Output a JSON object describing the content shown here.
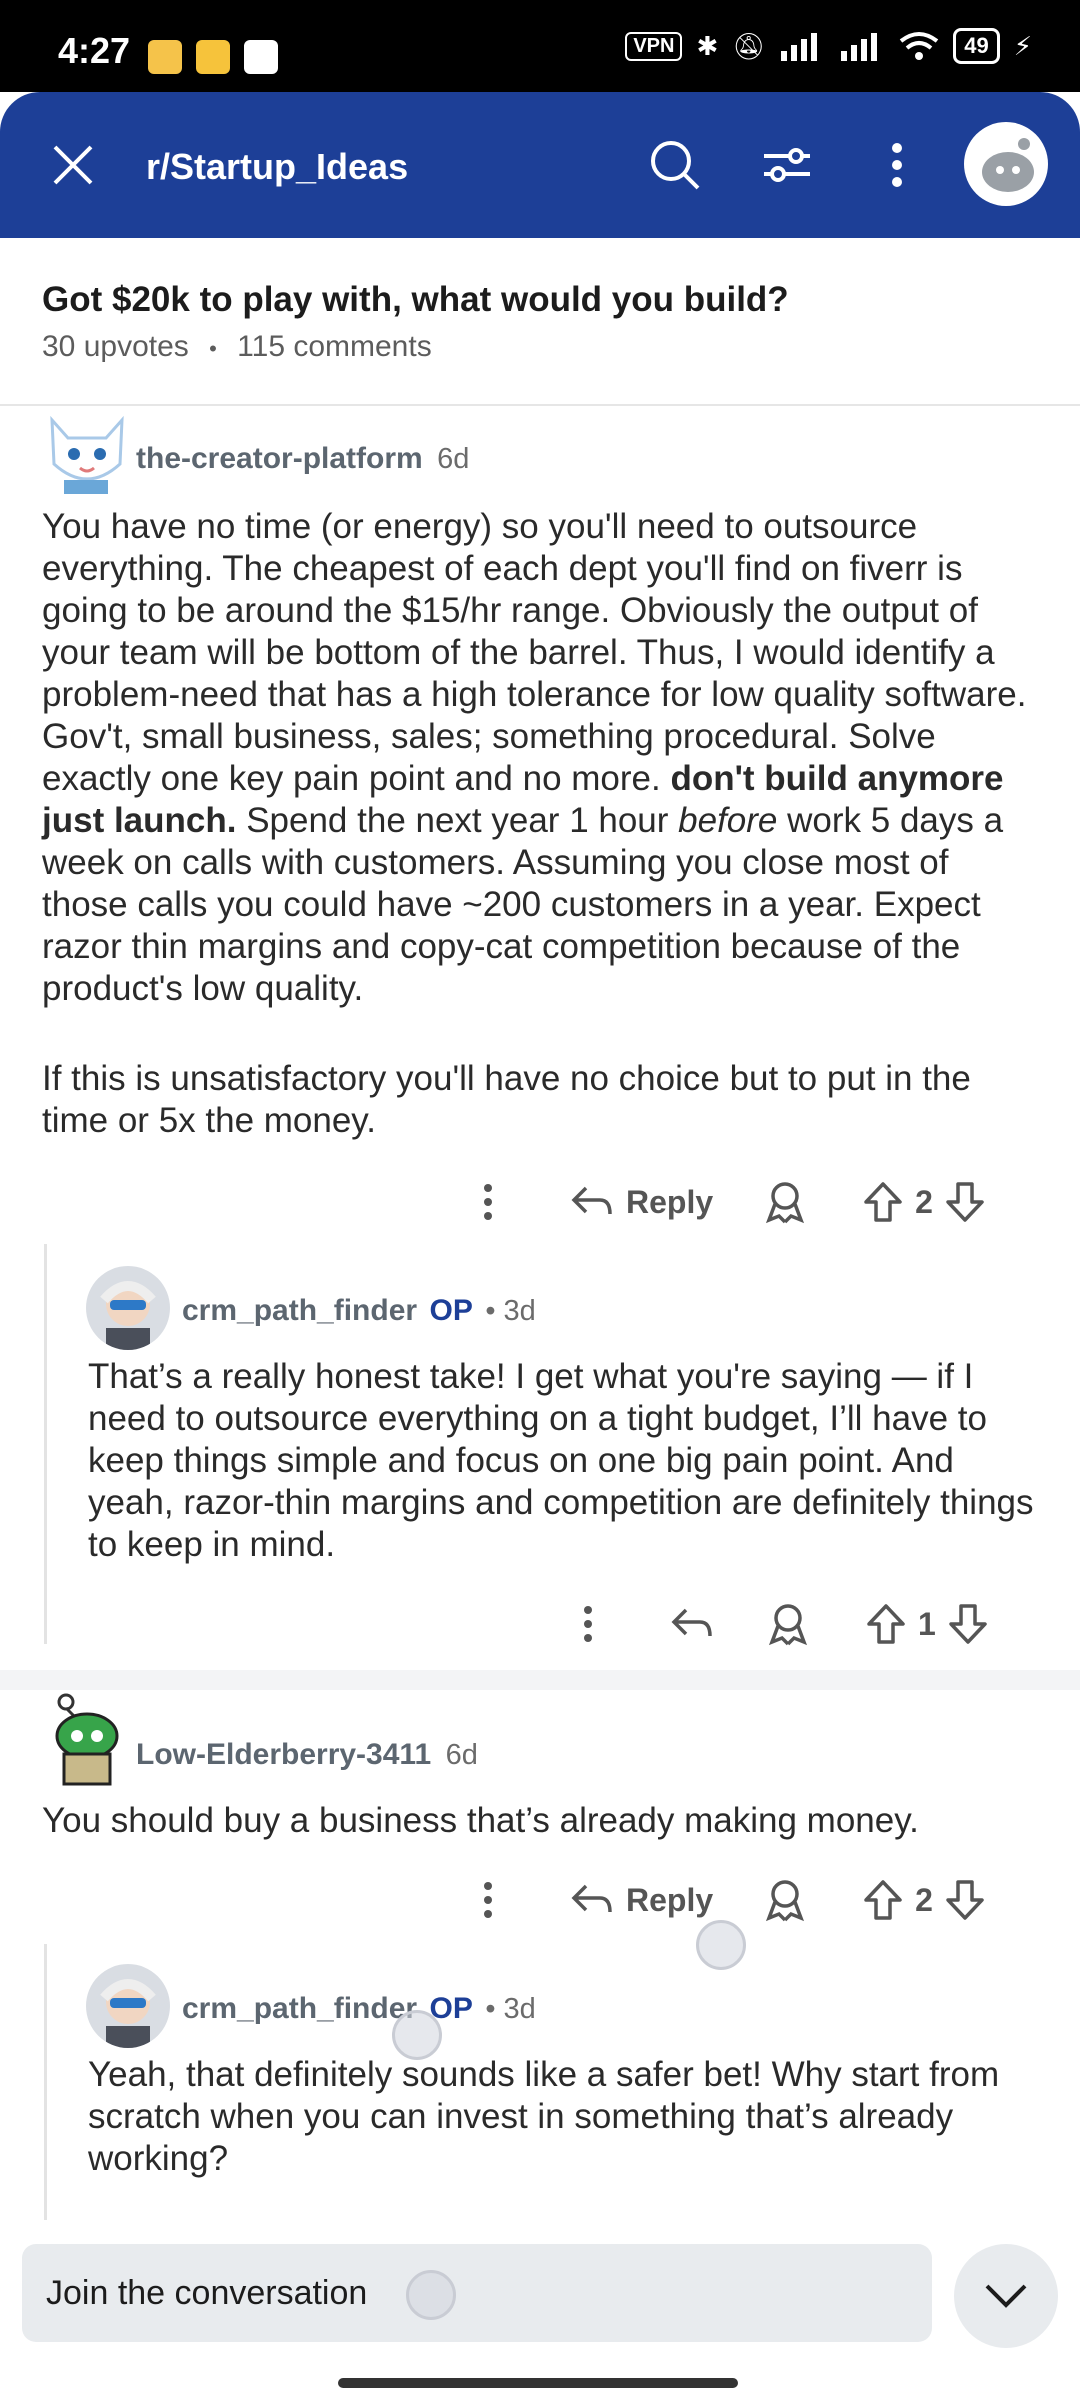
{
  "status": {
    "time": "4:27",
    "vpn": "VPN",
    "battery": "49"
  },
  "header": {
    "subreddit": "r/Startup_Ideas"
  },
  "post": {
    "title": "Got $20k to play with, what would you build?",
    "upvotes": "30 upvotes",
    "separator": "•",
    "comments": "115 comments"
  },
  "comments": [
    {
      "user": "the-creator-platform",
      "age": "6d",
      "p1_a": "You have no time (or energy) so you'll need to outsource everything. The cheapest of each dept you'll find on fiverr is going to be around the $15/hr range. Obviously the output of your team will be bottom of the barrel. Thus, I would identify a problem-need that has a high tolerance for low quality software. Gov't, small business, sales; something procedural. Solve exactly one key pain point and no more. ",
      "p1_bold": "don't build anymore just launch.",
      "p1_b": " Spend the next year 1 hour ",
      "p1_italic": "before",
      "p1_c": " work 5 days a week on calls with customers. Assuming you close most of those calls you could have ~200 customers in a year. Expect razor thin margins and copy-cat competition because of the product's low quality.",
      "p2": "If this is unsatisfactory you'll have no choice but to put in the time or 5x the money.",
      "reply_label": "Reply",
      "score": "2"
    },
    {
      "user": "crm_path_finder",
      "op": "OP",
      "age": "• 3d",
      "text": "That’s a really honest take! I get what you're saying — if I need to outsource everything on a tight budget, I’ll have to keep things simple and focus on one big pain point. And yeah, razor-thin margins and competition are definitely things to keep in mind.",
      "score": "1"
    },
    {
      "user": "Low-Elderberry-3411",
      "age": "6d",
      "text": "You should buy a business that’s already making money.",
      "reply_label": "Reply",
      "score": "2"
    },
    {
      "user": "crm_path_finder",
      "op": "OP",
      "age": "• 3d",
      "text": "Yeah, that definitely sounds like a safer bet! Why start from scratch when you can invest in something that’s already working?"
    }
  ],
  "composer": {
    "placeholder": "Join the conversation"
  }
}
